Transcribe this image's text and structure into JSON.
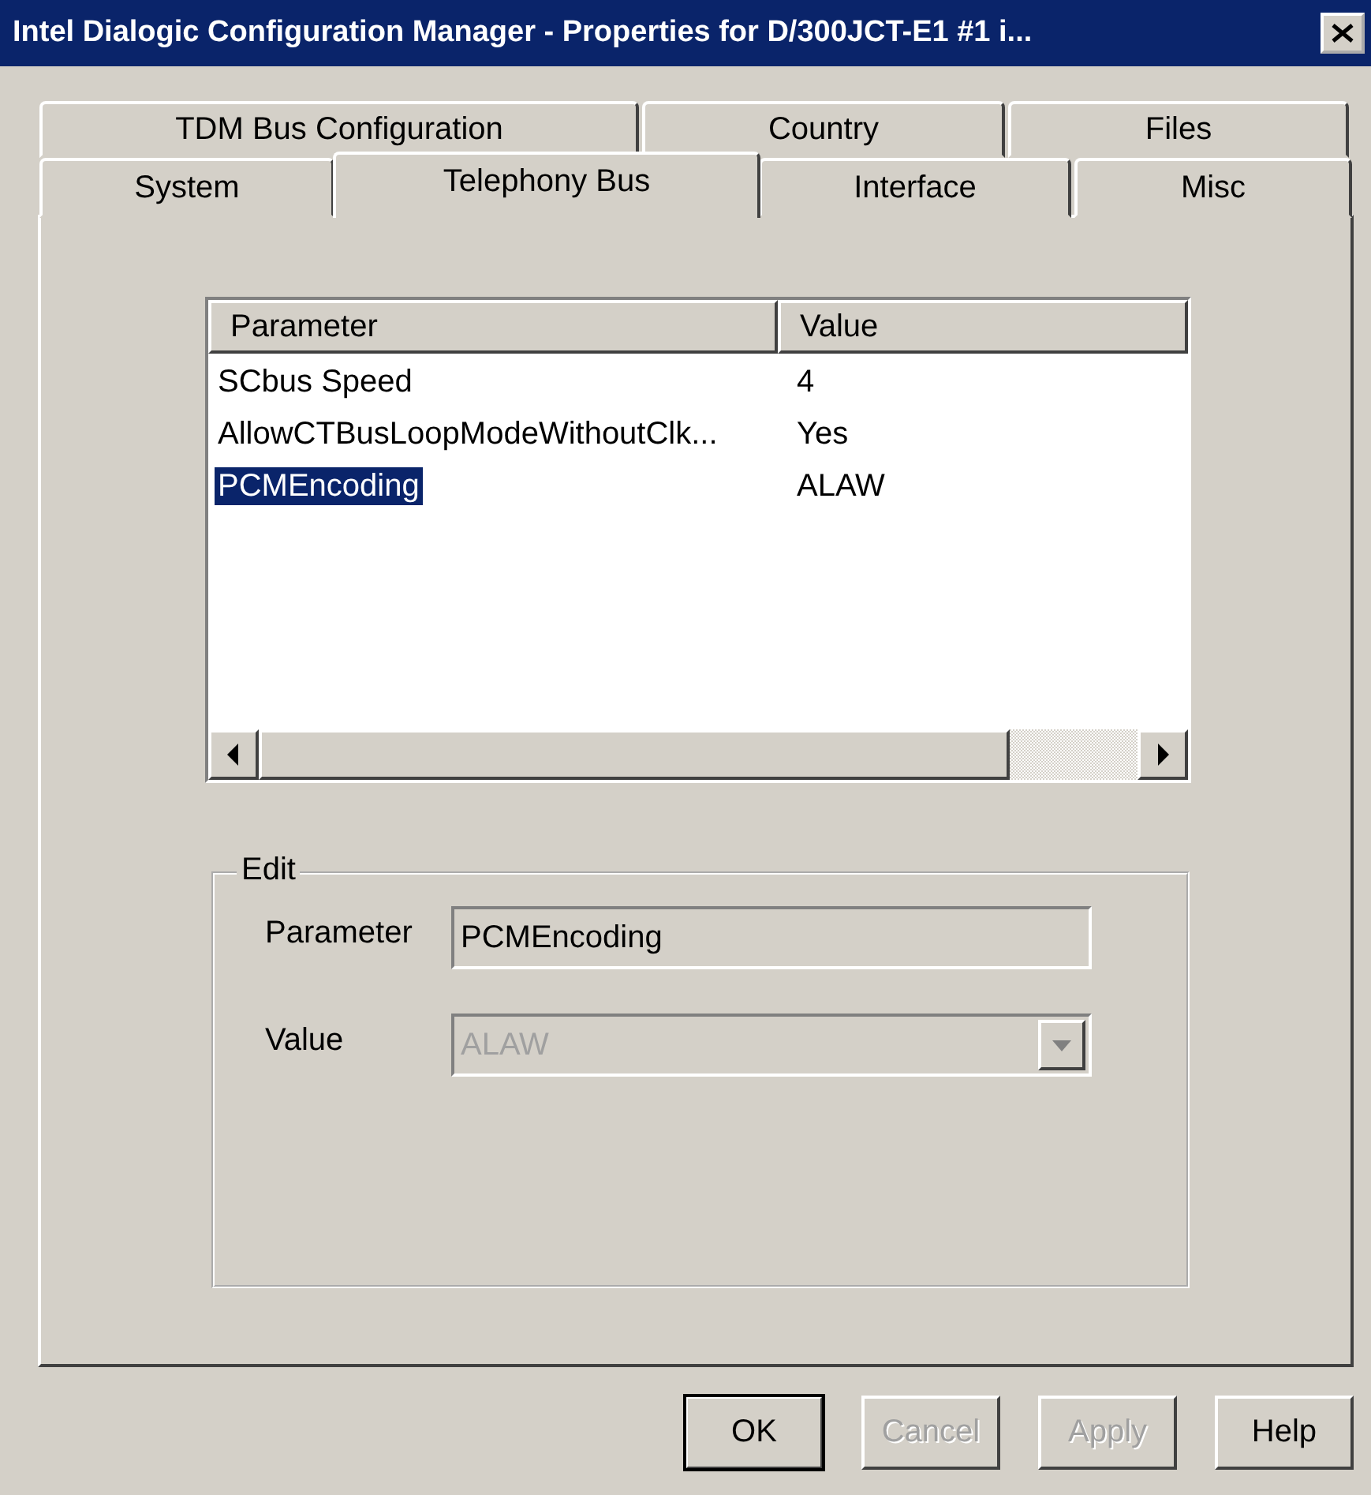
{
  "window": {
    "title": "Intel Dialogic Configuration Manager - Properties for D/300JCT-E1 #1 i..."
  },
  "tab_rows": [
    {
      "tabs": [
        {
          "label": "TDM Bus Configuration",
          "selected": false
        },
        {
          "label": "Country",
          "selected": false
        },
        {
          "label": "Files",
          "selected": false
        }
      ]
    },
    {
      "tabs": [
        {
          "label": "System",
          "selected": false
        },
        {
          "label": "Telephony Bus",
          "selected": true
        },
        {
          "label": "Interface",
          "selected": false
        },
        {
          "label": "Misc",
          "selected": false
        }
      ]
    }
  ],
  "table": {
    "columns": [
      "Parameter",
      "Value"
    ],
    "rows": [
      {
        "parameter": "SCbus Speed",
        "value": "4",
        "selected": false
      },
      {
        "parameter": "AllowCTBusLoopModeWithoutClk...",
        "value": "Yes",
        "selected": false
      },
      {
        "parameter": "PCMEncoding",
        "value": "ALAW",
        "selected": true
      }
    ]
  },
  "edit": {
    "title": "Edit",
    "parameter_label": "Parameter",
    "parameter_value": "PCMEncoding",
    "value_label": "Value",
    "value": "ALAW",
    "value_disabled": true
  },
  "buttons": [
    {
      "label": "OK",
      "default": true,
      "disabled": false
    },
    {
      "label": "Cancel",
      "default": false,
      "disabled": true
    },
    {
      "label": "Apply",
      "default": false,
      "disabled": true
    },
    {
      "label": "Help",
      "default": false,
      "disabled": false
    }
  ]
}
